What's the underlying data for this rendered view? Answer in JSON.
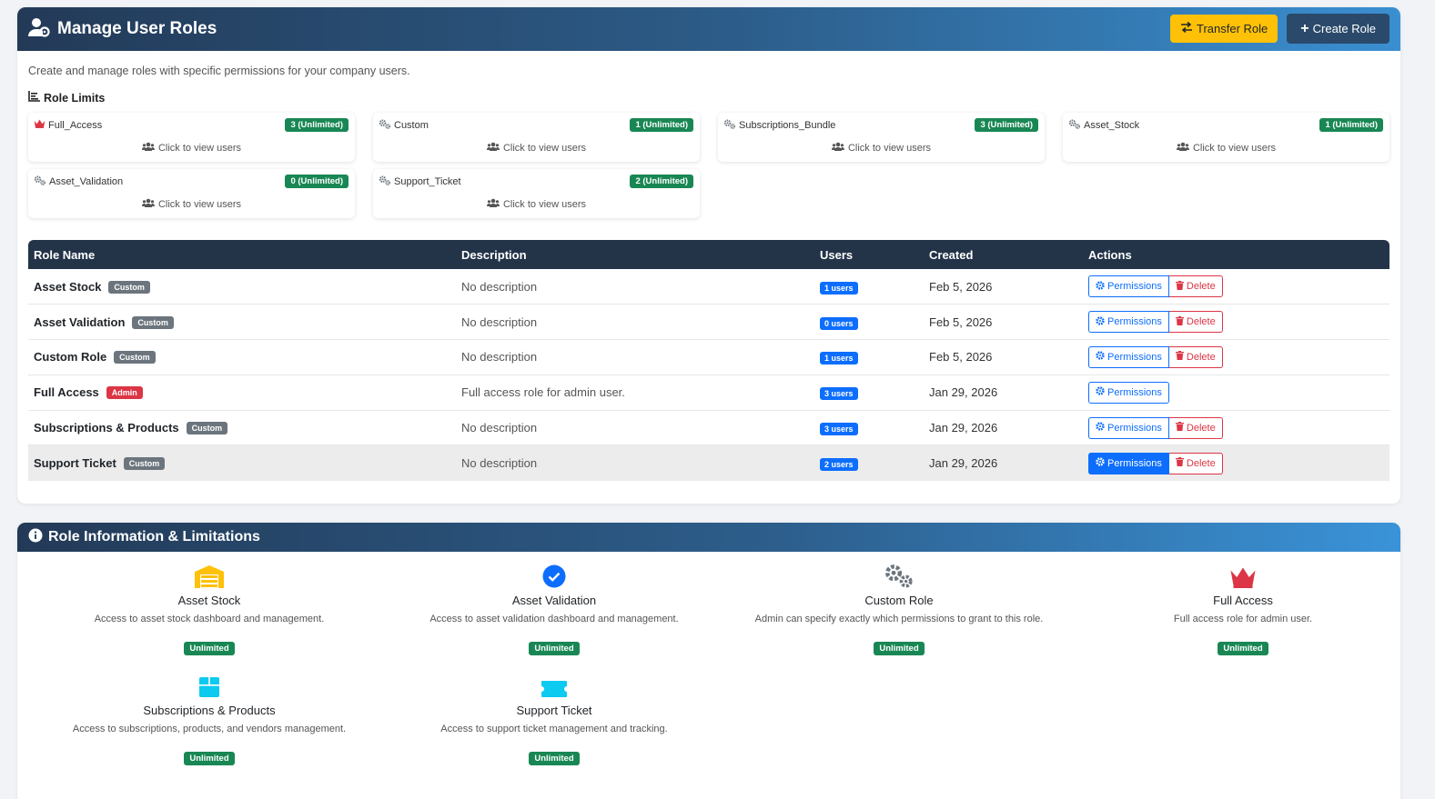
{
  "header": {
    "title": "Manage User Roles",
    "transfer_label": "Transfer Role",
    "create_label": "Create Role"
  },
  "subtitle": "Create and manage roles with specific permissions for your company users.",
  "role_limits": {
    "title": "Role Limits",
    "link_label": "Click to view users",
    "items": [
      {
        "name": "Full_Access",
        "icon": "crown-icon",
        "badge": "3 (Unlimited)"
      },
      {
        "name": "Custom",
        "icon": "gears-icon",
        "badge": "1 (Unlimited)"
      },
      {
        "name": "Subscriptions_Bundle",
        "icon": "gears-icon",
        "badge": "3 (Unlimited)"
      },
      {
        "name": "Asset_Stock",
        "icon": "gears-icon",
        "badge": "1 (Unlimited)"
      },
      {
        "name": "Asset_Validation",
        "icon": "gears-icon",
        "badge": "0 (Unlimited)"
      },
      {
        "name": "Support_Ticket",
        "icon": "gears-icon",
        "badge": "2 (Unlimited)"
      }
    ]
  },
  "table": {
    "columns": [
      "Role Name",
      "Description",
      "Users",
      "Created",
      "Actions"
    ],
    "permissions_label": "Permissions",
    "delete_label": "Delete",
    "rows": [
      {
        "name": "Asset Stock",
        "type": "Custom",
        "description": "No description",
        "users": "1 users",
        "created": "Feb 5, 2026"
      },
      {
        "name": "Asset Validation",
        "type": "Custom",
        "description": "No description",
        "users": "0 users",
        "created": "Feb 5, 2026"
      },
      {
        "name": "Custom Role",
        "type": "Custom",
        "description": "No description",
        "users": "1 users",
        "created": "Feb 5, 2026"
      },
      {
        "name": "Full Access",
        "type": "Admin",
        "description": "Full access role for admin user.",
        "users": "3 users",
        "created": "Jan 29, 2026"
      },
      {
        "name": "Subscriptions & Products",
        "type": "Custom",
        "description": "No description",
        "users": "3 users",
        "created": "Jan 29, 2026"
      },
      {
        "name": "Support Ticket",
        "type": "Custom",
        "description": "No description",
        "users": "2 users",
        "created": "Jan 29, 2026"
      }
    ]
  },
  "info": {
    "title": "Role Information & Limitations",
    "badge": "Unlimited",
    "items": [
      {
        "title": "Asset Stock",
        "desc": "Access to asset stock dashboard and management.",
        "icon": "warehouse-icon"
      },
      {
        "title": "Asset Validation",
        "desc": "Access to asset validation dashboard and management.",
        "icon": "check-circle-icon"
      },
      {
        "title": "Custom Role",
        "desc": "Admin can specify exactly which permissions to grant to this role.",
        "icon": "gears-icon"
      },
      {
        "title": "Full Access",
        "desc": "Full access role for admin user.",
        "icon": "crown-icon"
      },
      {
        "title": "Subscriptions & Products",
        "desc": "Access to subscriptions, products, and vendors management.",
        "icon": "box-icon"
      },
      {
        "title": "Support Ticket",
        "desc": "Access to support ticket management and tracking.",
        "icon": "ticket-icon"
      }
    ]
  },
  "colors": {
    "header_dark": "#233a57",
    "header_light": "#3a8fd1",
    "success": "#198754",
    "primary": "#0d6efd",
    "danger": "#dc3545",
    "warning": "#ffc107"
  }
}
